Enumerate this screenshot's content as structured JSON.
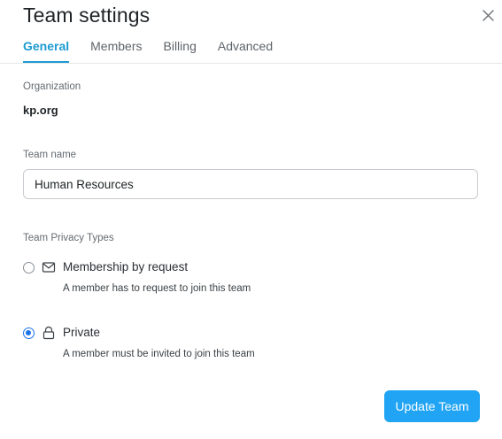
{
  "dialog": {
    "title": "Team settings",
    "close_icon": "close-icon"
  },
  "tabs": [
    {
      "label": "General",
      "active": true
    },
    {
      "label": "Members",
      "active": false
    },
    {
      "label": "Billing",
      "active": false
    },
    {
      "label": "Advanced",
      "active": false
    }
  ],
  "organization": {
    "label": "Organization",
    "value": "kp.org"
  },
  "team_name": {
    "label": "Team name",
    "value": "Human Resources"
  },
  "privacy": {
    "label": "Team Privacy Types",
    "options": [
      {
        "title": "Membership by request",
        "description": "A member has to request to join this team",
        "icon": "envelope-icon",
        "selected": false
      },
      {
        "title": "Private",
        "description": "A member must be invited to join this team",
        "icon": "lock-icon",
        "selected": true
      }
    ]
  },
  "actions": {
    "update_label": "Update Team"
  },
  "colors": {
    "accent": "#1d9bd1",
    "button": "#20a4f3",
    "radio_selected": "#1a73e8"
  }
}
